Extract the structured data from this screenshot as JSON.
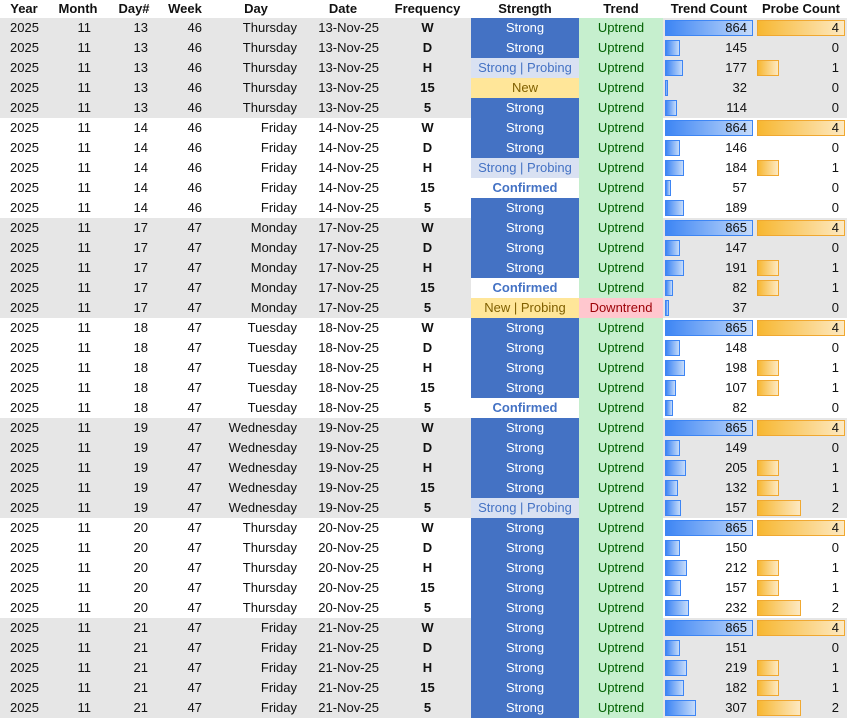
{
  "headers": [
    "Year",
    "Month",
    "Day#",
    "Week",
    "Day",
    "Date",
    "Frequency",
    "Strength",
    "Trend",
    "Trend Count",
    "Probe Count"
  ],
  "colors": {
    "strong_fill": "#4472c4",
    "probing_fill": "#d9e1f2",
    "new_fill": "#ffe699",
    "uptrend_fill": "#c6efce",
    "downtrend_fill": "#ffc7ce",
    "trend_bar": "#3d85f4",
    "probe_bar": "#f7b731",
    "band_gray": "#e6e6e6"
  },
  "scales": {
    "trend_count_max": 865,
    "probe_count_max": 4
  },
  "rows": [
    {
      "year": "2025",
      "month": "11",
      "day_num": "13",
      "week": "46",
      "day": "Thursday",
      "date": "13-Nov-25",
      "freq": "W",
      "strength": "Strong",
      "trend": "Uptrend",
      "trend_count": "864",
      "probe_count": "4"
    },
    {
      "year": "2025",
      "month": "11",
      "day_num": "13",
      "week": "46",
      "day": "Thursday",
      "date": "13-Nov-25",
      "freq": "D",
      "strength": "Strong",
      "trend": "Uptrend",
      "trend_count": "145",
      "probe_count": "0"
    },
    {
      "year": "2025",
      "month": "11",
      "day_num": "13",
      "week": "46",
      "day": "Thursday",
      "date": "13-Nov-25",
      "freq": "H",
      "strength": "Strong | Probing",
      "trend": "Uptrend",
      "trend_count": "177",
      "probe_count": "1"
    },
    {
      "year": "2025",
      "month": "11",
      "day_num": "13",
      "week": "46",
      "day": "Thursday",
      "date": "13-Nov-25",
      "freq": "15",
      "strength": "New",
      "trend": "Uptrend",
      "trend_count": "32",
      "probe_count": "0"
    },
    {
      "year": "2025",
      "month": "11",
      "day_num": "13",
      "week": "46",
      "day": "Thursday",
      "date": "13-Nov-25",
      "freq": "5",
      "strength": "Strong",
      "trend": "Uptrend",
      "trend_count": "114",
      "probe_count": "0"
    },
    {
      "year": "2025",
      "month": "11",
      "day_num": "14",
      "week": "46",
      "day": "Friday",
      "date": "14-Nov-25",
      "freq": "W",
      "strength": "Strong",
      "trend": "Uptrend",
      "trend_count": "864",
      "probe_count": "4"
    },
    {
      "year": "2025",
      "month": "11",
      "day_num": "14",
      "week": "46",
      "day": "Friday",
      "date": "14-Nov-25",
      "freq": "D",
      "strength": "Strong",
      "trend": "Uptrend",
      "trend_count": "146",
      "probe_count": "0"
    },
    {
      "year": "2025",
      "month": "11",
      "day_num": "14",
      "week": "46",
      "day": "Friday",
      "date": "14-Nov-25",
      "freq": "H",
      "strength": "Strong | Probing",
      "trend": "Uptrend",
      "trend_count": "184",
      "probe_count": "1"
    },
    {
      "year": "2025",
      "month": "11",
      "day_num": "14",
      "week": "46",
      "day": "Friday",
      "date": "14-Nov-25",
      "freq": "15",
      "strength": "Confirmed",
      "trend": "Uptrend",
      "trend_count": "57",
      "probe_count": "0"
    },
    {
      "year": "2025",
      "month": "11",
      "day_num": "14",
      "week": "46",
      "day": "Friday",
      "date": "14-Nov-25",
      "freq": "5",
      "strength": "Strong",
      "trend": "Uptrend",
      "trend_count": "189",
      "probe_count": "0"
    },
    {
      "year": "2025",
      "month": "11",
      "day_num": "17",
      "week": "47",
      "day": "Monday",
      "date": "17-Nov-25",
      "freq": "W",
      "strength": "Strong",
      "trend": "Uptrend",
      "trend_count": "865",
      "probe_count": "4"
    },
    {
      "year": "2025",
      "month": "11",
      "day_num": "17",
      "week": "47",
      "day": "Monday",
      "date": "17-Nov-25",
      "freq": "D",
      "strength": "Strong",
      "trend": "Uptrend",
      "trend_count": "147",
      "probe_count": "0"
    },
    {
      "year": "2025",
      "month": "11",
      "day_num": "17",
      "week": "47",
      "day": "Monday",
      "date": "17-Nov-25",
      "freq": "H",
      "strength": "Strong",
      "trend": "Uptrend",
      "trend_count": "191",
      "probe_count": "1"
    },
    {
      "year": "2025",
      "month": "11",
      "day_num": "17",
      "week": "47",
      "day": "Monday",
      "date": "17-Nov-25",
      "freq": "15",
      "strength": "Confirmed",
      "trend": "Uptrend",
      "trend_count": "82",
      "probe_count": "1"
    },
    {
      "year": "2025",
      "month": "11",
      "day_num": "17",
      "week": "47",
      "day": "Monday",
      "date": "17-Nov-25",
      "freq": "5",
      "strength": "New | Probing",
      "trend": "Downtrend",
      "trend_count": "37",
      "probe_count": "0"
    },
    {
      "year": "2025",
      "month": "11",
      "day_num": "18",
      "week": "47",
      "day": "Tuesday",
      "date": "18-Nov-25",
      "freq": "W",
      "strength": "Strong",
      "trend": "Uptrend",
      "trend_count": "865",
      "probe_count": "4"
    },
    {
      "year": "2025",
      "month": "11",
      "day_num": "18",
      "week": "47",
      "day": "Tuesday",
      "date": "18-Nov-25",
      "freq": "D",
      "strength": "Strong",
      "trend": "Uptrend",
      "trend_count": "148",
      "probe_count": "0"
    },
    {
      "year": "2025",
      "month": "11",
      "day_num": "18",
      "week": "47",
      "day": "Tuesday",
      "date": "18-Nov-25",
      "freq": "H",
      "strength": "Strong",
      "trend": "Uptrend",
      "trend_count": "198",
      "probe_count": "1"
    },
    {
      "year": "2025",
      "month": "11",
      "day_num": "18",
      "week": "47",
      "day": "Tuesday",
      "date": "18-Nov-25",
      "freq": "15",
      "strength": "Strong",
      "trend": "Uptrend",
      "trend_count": "107",
      "probe_count": "1"
    },
    {
      "year": "2025",
      "month": "11",
      "day_num": "18",
      "week": "47",
      "day": "Tuesday",
      "date": "18-Nov-25",
      "freq": "5",
      "strength": "Confirmed",
      "trend": "Uptrend",
      "trend_count": "82",
      "probe_count": "0"
    },
    {
      "year": "2025",
      "month": "11",
      "day_num": "19",
      "week": "47",
      "day": "Wednesday",
      "date": "19-Nov-25",
      "freq": "W",
      "strength": "Strong",
      "trend": "Uptrend",
      "trend_count": "865",
      "probe_count": "4"
    },
    {
      "year": "2025",
      "month": "11",
      "day_num": "19",
      "week": "47",
      "day": "Wednesday",
      "date": "19-Nov-25",
      "freq": "D",
      "strength": "Strong",
      "trend": "Uptrend",
      "trend_count": "149",
      "probe_count": "0"
    },
    {
      "year": "2025",
      "month": "11",
      "day_num": "19",
      "week": "47",
      "day": "Wednesday",
      "date": "19-Nov-25",
      "freq": "H",
      "strength": "Strong",
      "trend": "Uptrend",
      "trend_count": "205",
      "probe_count": "1"
    },
    {
      "year": "2025",
      "month": "11",
      "day_num": "19",
      "week": "47",
      "day": "Wednesday",
      "date": "19-Nov-25",
      "freq": "15",
      "strength": "Strong",
      "trend": "Uptrend",
      "trend_count": "132",
      "probe_count": "1"
    },
    {
      "year": "2025",
      "month": "11",
      "day_num": "19",
      "week": "47",
      "day": "Wednesday",
      "date": "19-Nov-25",
      "freq": "5",
      "strength": "Strong | Probing",
      "trend": "Uptrend",
      "trend_count": "157",
      "probe_count": "2"
    },
    {
      "year": "2025",
      "month": "11",
      "day_num": "20",
      "week": "47",
      "day": "Thursday",
      "date": "20-Nov-25",
      "freq": "W",
      "strength": "Strong",
      "trend": "Uptrend",
      "trend_count": "865",
      "probe_count": "4"
    },
    {
      "year": "2025",
      "month": "11",
      "day_num": "20",
      "week": "47",
      "day": "Thursday",
      "date": "20-Nov-25",
      "freq": "D",
      "strength": "Strong",
      "trend": "Uptrend",
      "trend_count": "150",
      "probe_count": "0"
    },
    {
      "year": "2025",
      "month": "11",
      "day_num": "20",
      "week": "47",
      "day": "Thursday",
      "date": "20-Nov-25",
      "freq": "H",
      "strength": "Strong",
      "trend": "Uptrend",
      "trend_count": "212",
      "probe_count": "1"
    },
    {
      "year": "2025",
      "month": "11",
      "day_num": "20",
      "week": "47",
      "day": "Thursday",
      "date": "20-Nov-25",
      "freq": "15",
      "strength": "Strong",
      "trend": "Uptrend",
      "trend_count": "157",
      "probe_count": "1"
    },
    {
      "year": "2025",
      "month": "11",
      "day_num": "20",
      "week": "47",
      "day": "Thursday",
      "date": "20-Nov-25",
      "freq": "5",
      "strength": "Strong",
      "trend": "Uptrend",
      "trend_count": "232",
      "probe_count": "2"
    },
    {
      "year": "2025",
      "month": "11",
      "day_num": "21",
      "week": "47",
      "day": "Friday",
      "date": "21-Nov-25",
      "freq": "W",
      "strength": "Strong",
      "trend": "Uptrend",
      "trend_count": "865",
      "probe_count": "4"
    },
    {
      "year": "2025",
      "month": "11",
      "day_num": "21",
      "week": "47",
      "day": "Friday",
      "date": "21-Nov-25",
      "freq": "D",
      "strength": "Strong",
      "trend": "Uptrend",
      "trend_count": "151",
      "probe_count": "0"
    },
    {
      "year": "2025",
      "month": "11",
      "day_num": "21",
      "week": "47",
      "day": "Friday",
      "date": "21-Nov-25",
      "freq": "H",
      "strength": "Strong",
      "trend": "Uptrend",
      "trend_count": "219",
      "probe_count": "1"
    },
    {
      "year": "2025",
      "month": "11",
      "day_num": "21",
      "week": "47",
      "day": "Friday",
      "date": "21-Nov-25",
      "freq": "15",
      "strength": "Strong",
      "trend": "Uptrend",
      "trend_count": "182",
      "probe_count": "1"
    },
    {
      "year": "2025",
      "month": "11",
      "day_num": "21",
      "week": "47",
      "day": "Friday",
      "date": "21-Nov-25",
      "freq": "5",
      "strength": "Strong",
      "trend": "Uptrend",
      "trend_count": "307",
      "probe_count": "2"
    }
  ]
}
